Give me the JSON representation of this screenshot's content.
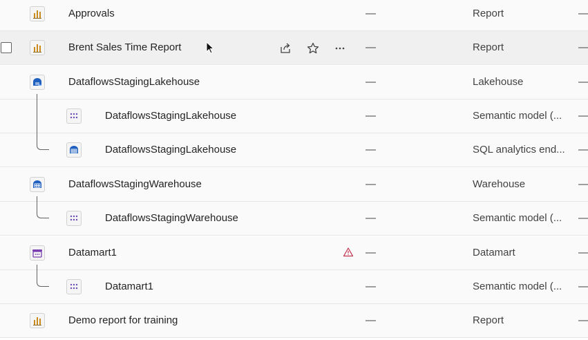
{
  "rows": [
    {
      "name": "Approvals",
      "type": "Report",
      "col1": "—",
      "col2": "—"
    },
    {
      "name": "Brent Sales Time Report",
      "type": "Report",
      "col1": "—",
      "col2": "—"
    },
    {
      "name": "DataflowsStagingLakehouse",
      "type": "Lakehouse",
      "col1": "—",
      "col2": "—"
    },
    {
      "name": "DataflowsStagingLakehouse",
      "type": "Semantic model (...",
      "col1": "—",
      "col2": "—"
    },
    {
      "name": "DataflowsStagingLakehouse",
      "type": "SQL analytics end...",
      "col1": "—",
      "col2": "—"
    },
    {
      "name": "DataflowsStagingWarehouse",
      "type": "Warehouse",
      "col1": "—",
      "col2": "—"
    },
    {
      "name": "DataflowsStagingWarehouse",
      "type": "Semantic model (...",
      "col1": "—",
      "col2": "—"
    },
    {
      "name": "Datamart1",
      "type": "Datamart",
      "col1": "—",
      "col2": "—"
    },
    {
      "name": "Datamart1",
      "type": "Semantic model (...",
      "col1": "—",
      "col2": "—"
    },
    {
      "name": "Demo report for training",
      "type": "Report",
      "col1": "—",
      "col2": "—"
    }
  ],
  "icons": {
    "report": "report-icon",
    "lakehouse": "lakehouse-icon",
    "semantic_model": "semantic-model-icon",
    "sql_endpoint": "sql-analytics-endpoint-icon",
    "warehouse": "warehouse-icon",
    "datamart": "datamart-icon",
    "share": "share-icon",
    "favorite": "star-icon",
    "more": "more-options-icon",
    "warning": "warning-icon"
  },
  "colors": {
    "report_accent": "#c98a1b",
    "lakehouse_accent": "#1f5fbf",
    "semantic_accent": "#6a4bb3",
    "datamart_accent": "#7a3fb0",
    "warning": "#c4314b"
  }
}
